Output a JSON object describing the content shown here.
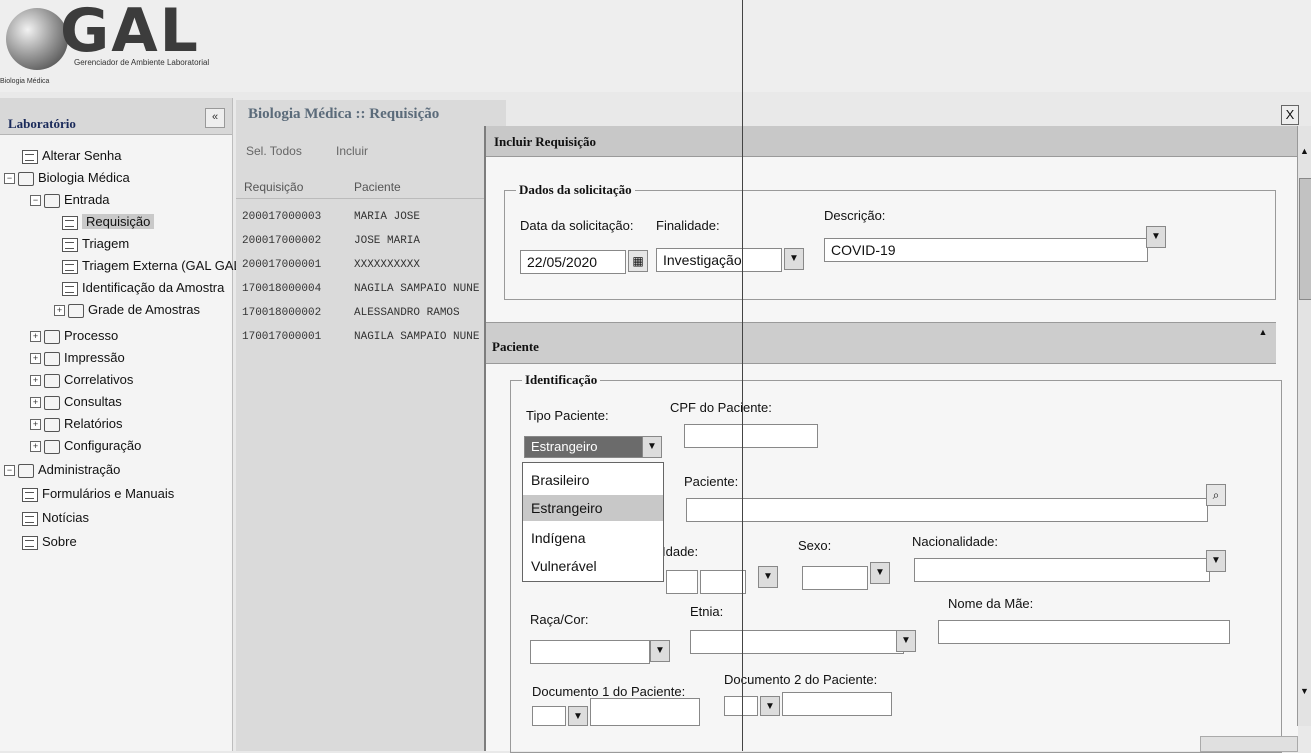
{
  "header": {
    "logo_text": "GAL",
    "logo_subtitle": "Gerenciador de Ambiente Laboratorial",
    "logo_subtitle_2": "Biologia Médica"
  },
  "sidebar": {
    "title": "Laboratório",
    "collapse_label": "«",
    "items": [
      {
        "label": "Alterar Senha"
      },
      {
        "label": "Biologia Médica"
      },
      {
        "label": "Entrada"
      },
      {
        "label": "Requisição"
      },
      {
        "label": "Triagem"
      },
      {
        "label": "Triagem Externa (GAL GAL"
      },
      {
        "label": "Identificação da Amostra"
      },
      {
        "label": "Grade de Amostras"
      },
      {
        "label": "Processo"
      },
      {
        "label": "Impressão"
      },
      {
        "label": "Correlativos"
      },
      {
        "label": "Consultas"
      },
      {
        "label": "Relatórios"
      },
      {
        "label": "Configuração"
      },
      {
        "label": "Administração"
      },
      {
        "label": "Formulários e Manuais"
      },
      {
        "label": "Notícias"
      },
      {
        "label": "Sobre"
      }
    ]
  },
  "list_panel": {
    "title": "Biologia Médica :: Requisição",
    "toolbar": {
      "select_all": "Sel. Todos",
      "include": "Incluir"
    },
    "columns": [
      "Requisição",
      "Paciente"
    ],
    "rows": [
      {
        "requisicao": "200017000003",
        "paciente": "MARIA JOSE"
      },
      {
        "requisicao": "200017000002",
        "paciente": "JOSE MARIA"
      },
      {
        "requisicao": "200017000001",
        "paciente": "XXXXXXXXXX"
      },
      {
        "requisicao": "170018000004",
        "paciente": "NAGILA SAMPAIO NUNE"
      },
      {
        "requisicao": "170018000002",
        "paciente": "ALESSANDRO RAMOS"
      },
      {
        "requisicao": "170017000001",
        "paciente": "NAGILA SAMPAIO NUNE"
      }
    ]
  },
  "dialog": {
    "title": "Incluir Requisição",
    "close_label": "X",
    "solicitacao": {
      "legend": "Dados da solicitação",
      "data_label": "Data da solicitação:",
      "data_value": "22/05/2020",
      "finalidade_label": "Finalidade:",
      "finalidade_value": "Investigação",
      "descricao_label": "Descrição:",
      "descricao_value": "COVID-19"
    },
    "paciente": {
      "section_title": "Paciente",
      "identificacao_legend": "Identificação",
      "tipo_label": "Tipo Paciente:",
      "tipo_value": "Estrangeiro",
      "tipo_options": [
        "Brasileiro",
        "Estrangeiro",
        "Indígena",
        "Vulnerável"
      ],
      "cpf_label": "CPF do Paciente:",
      "paciente_label": "Paciente:",
      "idade_label": "Idade:",
      "sexo_label": "Sexo:",
      "nacionalidade_label": "Nacionalidade:",
      "raca_label": "Raça/Cor:",
      "etnia_label": "Etnia:",
      "nome_mae_label": "Nome da Mãe:",
      "doc1_label": "Documento 1 do Paciente:",
      "doc2_label": "Documento 2 do Paciente:"
    }
  },
  "colors": {
    "accent": "#1a2a5a",
    "highlight": "#c8c8c8"
  }
}
